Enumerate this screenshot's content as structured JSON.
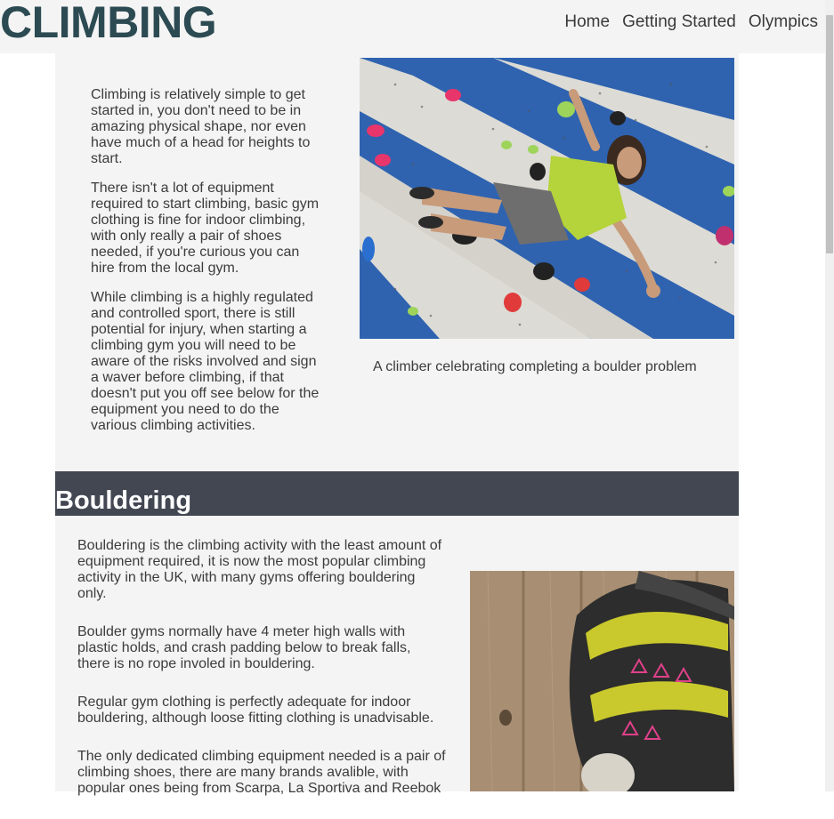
{
  "header": {
    "logo": "CLIMBING",
    "nav": [
      "Home",
      "Getting Started",
      "Olympics"
    ]
  },
  "intro": {
    "paragraphs": [
      "Climbing is relatively simple to get started in, you don't need to be in amazing physical shape, nor even have much of a head for heights to start.",
      "There isn't a lot of equipment required to start climbing, basic gym clothing is fine for indoor climbing, with only really a pair of shoes needed, if you're curious you can hire from the local gym.",
      "While climbing is a highly regulated and controlled sport, there is still potential for injury, when starting a climbing gym you will need to be aware of the risks involved and sign a waver before climbing, if that doesn't put you off see below for the equipment you need to do the various climbing activities."
    ],
    "caption": "A climber celebrating completing a boulder problem"
  },
  "bouldering": {
    "title": "Bouldering",
    "paragraphs": [
      "Bouldering is the climbing activity with the least amount of equipment required, it is now the most popular climbing activity in the UK, with many gyms offering bouldering only.",
      "Boulder gyms normally have 4 meter high walls with plastic holds, and crash padding below to break falls, there is no rope involed in bouldering.",
      "Regular gym clothing is perfectly adequate for indoor bouldering, although loose fitting clothing is unadvisable.",
      "The only dedicated climbing equipment needed is a pair of climbing shoes, there are many brands avalible, with popular ones being from Scarpa, La Sportiva and Reebok"
    ]
  },
  "colors": {
    "logo": "#2c4a52",
    "section_bar": "#424752",
    "page_bg": "#f4f4f4"
  }
}
